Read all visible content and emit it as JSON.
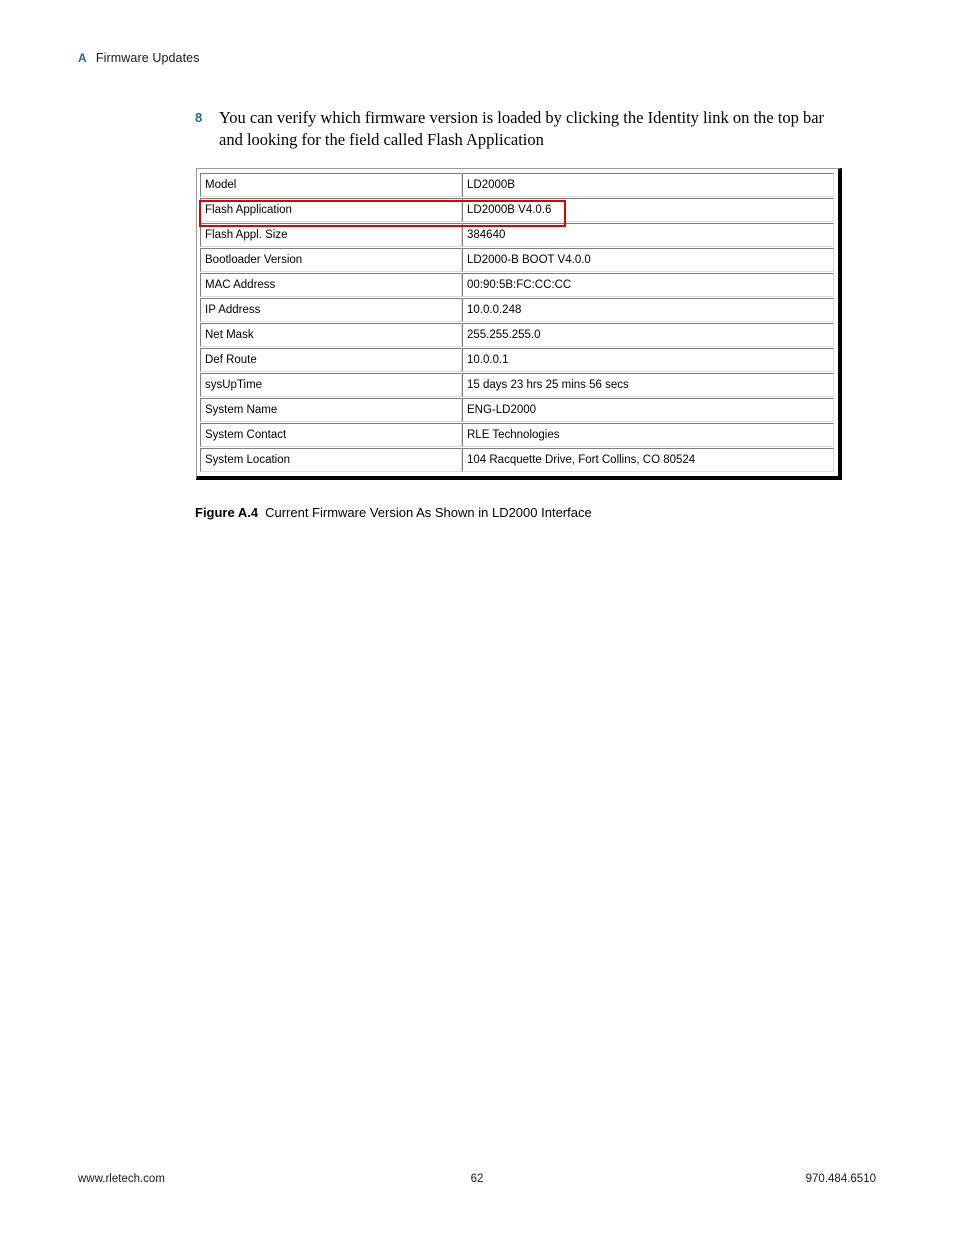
{
  "header": {
    "appendix_letter": "A",
    "title": "Firmware Updates",
    "accent_color": "#1f6b8c"
  },
  "step": {
    "number": "8",
    "text": "You can verify which firmware version is loaded by clicking the Identity link on the top bar and looking for the field called Flash Application"
  },
  "figure": {
    "caption_label": "Figure A.4",
    "caption_text": "Current Firmware Version As Shown in LD2000 Interface",
    "highlight_color": "#e00000",
    "highlighted_row": "Flash Application",
    "rows": [
      {
        "label": "Model",
        "value": "LD2000B"
      },
      {
        "label": "Flash Application",
        "value": "LD2000B V4.0.6"
      },
      {
        "label": "Flash Appl. Size",
        "value": "384640"
      },
      {
        "label": "Bootloader Version",
        "value": "LD2000-B BOOT V4.0.0"
      },
      {
        "label": "MAC Address",
        "value": "00:90:5B:FC:CC:CC"
      },
      {
        "label": "IP Address",
        "value": "10.0.0.248"
      },
      {
        "label": "Net Mask",
        "value": "255.255.255.0"
      },
      {
        "label": "Def Route",
        "value": "10.0.0.1"
      },
      {
        "label": "sysUpTime",
        "value": "15 days 23 hrs 25 mins 56 secs"
      },
      {
        "label": "System Name",
        "value": "ENG-LD2000"
      },
      {
        "label": "System Contact",
        "value": "RLE Technologies"
      },
      {
        "label": "System Location",
        "value": "104 Racquette Drive, Fort Collins, CO 80524"
      }
    ]
  },
  "footer": {
    "website": "www.rletech.com",
    "page_number": "62",
    "phone": "970.484.6510"
  }
}
